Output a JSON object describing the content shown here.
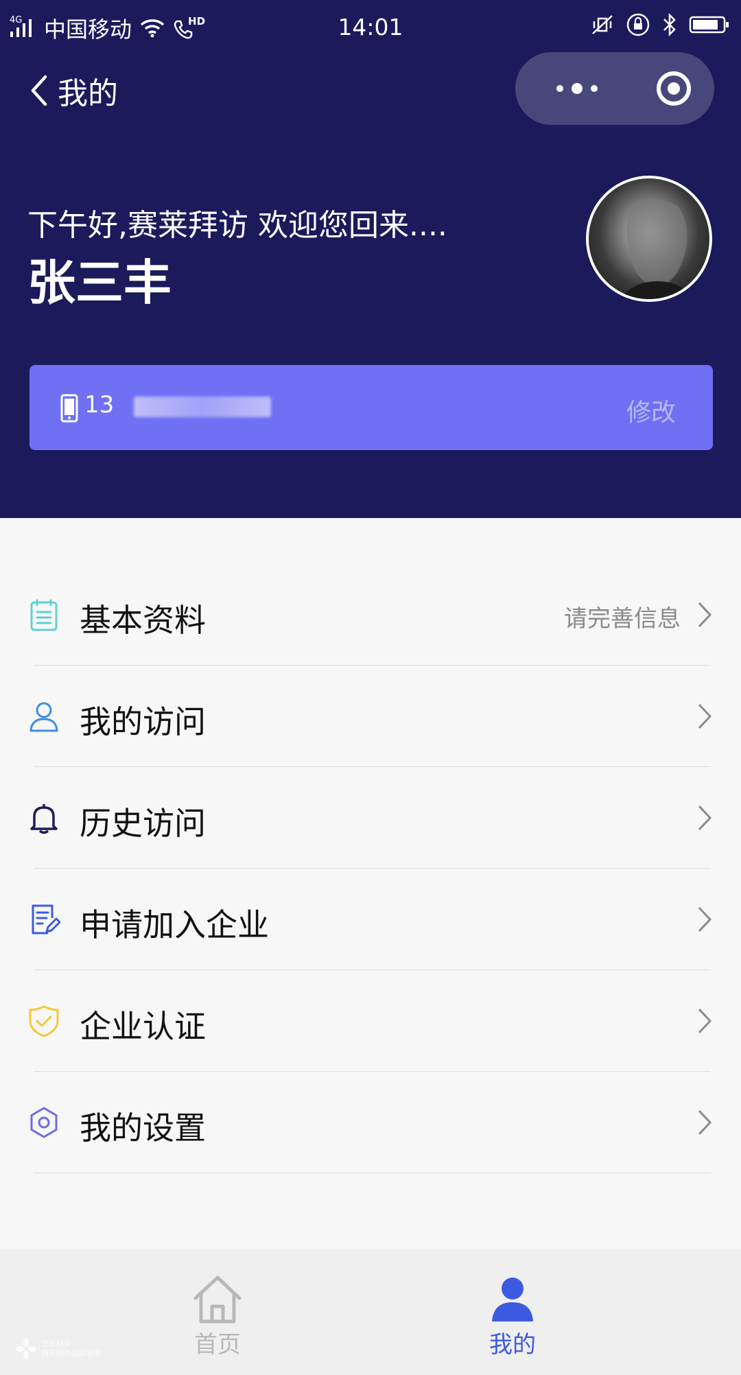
{
  "status_bar": {
    "network": "4G",
    "carrier": "中国移动",
    "hd": "HD",
    "time": "14:01"
  },
  "nav": {
    "title": "我的"
  },
  "profile": {
    "greeting": "下午好,赛莱拜访 欢迎您回来....",
    "name": "张三丰",
    "phone_prefix": "13",
    "edit_label": "修改"
  },
  "menu": {
    "items": [
      {
        "label": "基本资料",
        "hint": "请完善信息",
        "icon": "clipboard-icon",
        "color": "#5fd0d6"
      },
      {
        "label": "我的访问",
        "hint": "",
        "icon": "user-icon",
        "color": "#3f8de6"
      },
      {
        "label": "历史访问",
        "hint": "",
        "icon": "bell-icon",
        "color": "#1b1a5b"
      },
      {
        "label": "申请加入企业",
        "hint": "",
        "icon": "edit-document-icon",
        "color": "#3d5be0"
      },
      {
        "label": "企业认证",
        "hint": "",
        "icon": "shield-check-icon",
        "color": "#f5c83a"
      },
      {
        "label": "我的设置",
        "hint": "",
        "icon": "gear-icon",
        "color": "#6b6be8"
      }
    ]
  },
  "tabbar": {
    "tabs": [
      {
        "label": "首页",
        "icon": "home-icon",
        "active": false
      },
      {
        "label": "我的",
        "icon": "person-icon",
        "active": true
      }
    ]
  },
  "watermark": {
    "line1": "空谷科技",
    "line2": "梅花网作品库收录"
  },
  "colors": {
    "header_bg": "#1b1a5b",
    "phone_bar": "#7070f4",
    "accent": "#3d5be0",
    "page_bg": "#f7f7f7"
  }
}
